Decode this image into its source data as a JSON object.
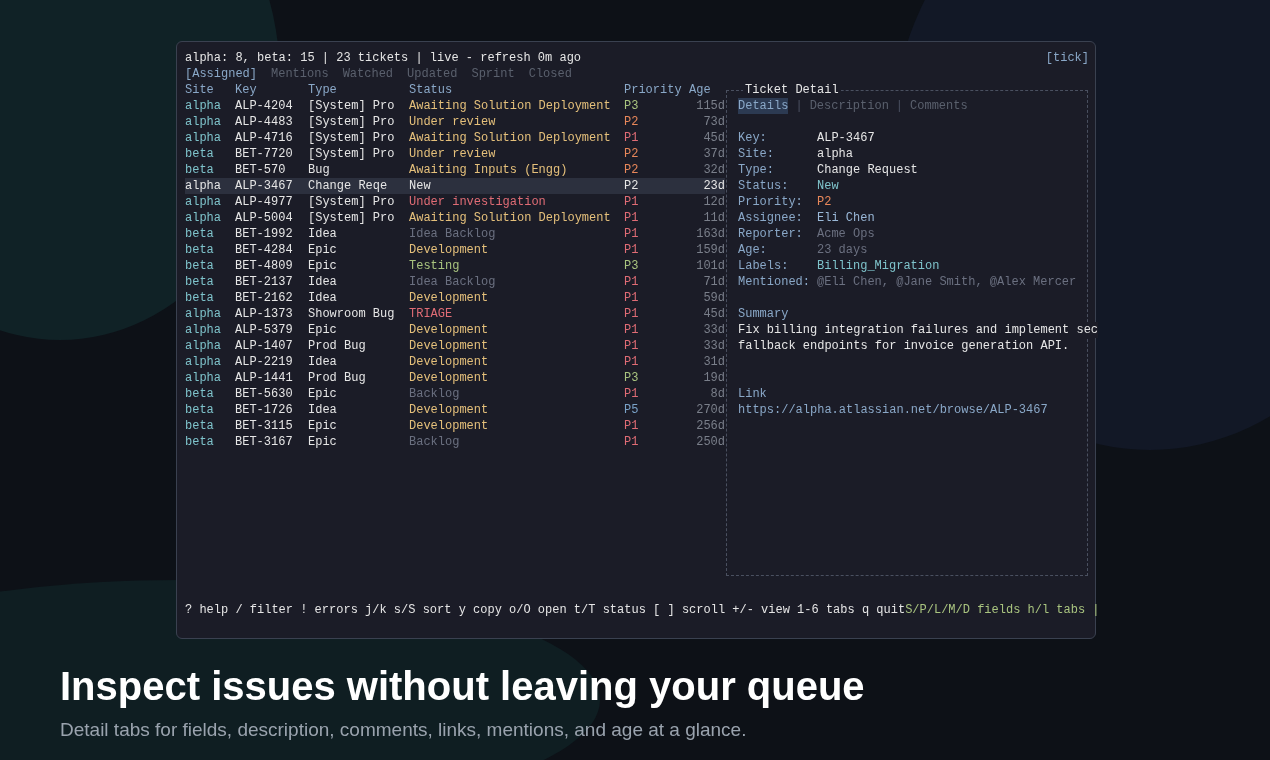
{
  "header": {
    "summary": "alpha: 8, beta: 15 | 23 tickets | live - refresh 0m ago",
    "tick": "[tick]"
  },
  "tabs": [
    {
      "label": "[Assigned]",
      "selected": true
    },
    {
      "label": "Mentions",
      "selected": false
    },
    {
      "label": "Watched",
      "selected": false
    },
    {
      "label": "Updated",
      "selected": false
    },
    {
      "label": "Sprint",
      "selected": false
    },
    {
      "label": "Closed",
      "selected": false
    }
  ],
  "table": {
    "columns": [
      "Site",
      "Key",
      "Type",
      "Status",
      "Priority",
      "Age"
    ],
    "rows": [
      {
        "site": "alpha",
        "key": "ALP-4204",
        "type": "[System] Pro",
        "status": {
          "text": "Awaiting Solution Deployment",
          "color": "#e5c07b"
        },
        "priority": {
          "text": "P3",
          "color": "#a9c47f"
        },
        "age": "115d",
        "selected": false
      },
      {
        "site": "alpha",
        "key": "ALP-4483",
        "type": "[System] Pro",
        "status": {
          "text": "Under review",
          "color": "#e5c07b"
        },
        "priority": {
          "text": "P2",
          "color": "#e8875a"
        },
        "age": "73d",
        "selected": false
      },
      {
        "site": "alpha",
        "key": "ALP-4716",
        "type": "[System] Pro",
        "status": {
          "text": "Awaiting Solution Deployment",
          "color": "#e5c07b"
        },
        "priority": {
          "text": "P1",
          "color": "#e06c75"
        },
        "age": "45d",
        "selected": false
      },
      {
        "site": "beta",
        "key": "BET-7720",
        "type": "[System] Pro",
        "status": {
          "text": "Under review",
          "color": "#e5c07b"
        },
        "priority": {
          "text": "P2",
          "color": "#e8875a"
        },
        "age": "37d",
        "selected": false
      },
      {
        "site": "beta",
        "key": "BET-570",
        "type": "Bug",
        "status": {
          "text": "Awaiting Inputs (Engg)",
          "color": "#e5c07b"
        },
        "priority": {
          "text": "P2",
          "color": "#e8875a"
        },
        "age": "32d",
        "selected": false
      },
      {
        "site": "alpha",
        "key": "ALP-3467",
        "type": "Change Reqe",
        "status": {
          "text": "New",
          "color": "#e6e6e6"
        },
        "priority": {
          "text": "P2",
          "color": "#e6e6e6"
        },
        "age": "23d",
        "selected": true
      },
      {
        "site": "alpha",
        "key": "ALP-4977",
        "type": "[System] Pro",
        "status": {
          "text": "Under investigation",
          "color": "#e06c75"
        },
        "priority": {
          "text": "P1",
          "color": "#e06c75"
        },
        "age": "12d",
        "selected": false
      },
      {
        "site": "alpha",
        "key": "ALP-5004",
        "type": "[System] Pro",
        "status": {
          "text": "Awaiting Solution Deployment",
          "color": "#e5c07b"
        },
        "priority": {
          "text": "P1",
          "color": "#e06c75"
        },
        "age": "11d",
        "selected": false
      },
      {
        "site": "beta",
        "key": "BET-1992",
        "type": "Idea",
        "status": {
          "text": "Idea Backlog",
          "color": "#6b7080"
        },
        "priority": {
          "text": "P1",
          "color": "#e06c75"
        },
        "age": "163d",
        "selected": false
      },
      {
        "site": "beta",
        "key": "BET-4284",
        "type": "Epic",
        "status": {
          "text": "Development",
          "color": "#e5c07b"
        },
        "priority": {
          "text": "P1",
          "color": "#e06c75"
        },
        "age": "159d",
        "selected": false
      },
      {
        "site": "beta",
        "key": "BET-4809",
        "type": "Epic",
        "status": {
          "text": "Testing",
          "color": "#a9c47f"
        },
        "priority": {
          "text": "P3",
          "color": "#a9c47f"
        },
        "age": "101d",
        "selected": false
      },
      {
        "site": "beta",
        "key": "BET-2137",
        "type": "Idea",
        "status": {
          "text": "Idea Backlog",
          "color": "#6b7080"
        },
        "priority": {
          "text": "P1",
          "color": "#e06c75"
        },
        "age": "71d",
        "selected": false
      },
      {
        "site": "beta",
        "key": "BET-2162",
        "type": "Idea",
        "status": {
          "text": "Development",
          "color": "#e5c07b"
        },
        "priority": {
          "text": "P1",
          "color": "#e06c75"
        },
        "age": "59d",
        "selected": false
      },
      {
        "site": "alpha",
        "key": "ALP-1373",
        "type": "Showroom Bug",
        "status": {
          "text": "TRIAGE",
          "color": "#e06c75"
        },
        "priority": {
          "text": "P1",
          "color": "#e06c75"
        },
        "age": "45d",
        "selected": false
      },
      {
        "site": "alpha",
        "key": "ALP-5379",
        "type": "Epic",
        "status": {
          "text": "Development",
          "color": "#e5c07b"
        },
        "priority": {
          "text": "P1",
          "color": "#e06c75"
        },
        "age": "33d",
        "selected": false
      },
      {
        "site": "alpha",
        "key": "ALP-1407",
        "type": "Prod Bug",
        "status": {
          "text": "Development",
          "color": "#e5c07b"
        },
        "priority": {
          "text": "P1",
          "color": "#e06c75"
        },
        "age": "33d",
        "selected": false
      },
      {
        "site": "alpha",
        "key": "ALP-2219",
        "type": "Idea",
        "status": {
          "text": "Development",
          "color": "#e5c07b"
        },
        "priority": {
          "text": "P1",
          "color": "#e06c75"
        },
        "age": "31d",
        "selected": false
      },
      {
        "site": "alpha",
        "key": "ALP-1441",
        "type": "Prod Bug",
        "status": {
          "text": "Development",
          "color": "#e5c07b"
        },
        "priority": {
          "text": "P3",
          "color": "#a9c47f"
        },
        "age": "19d",
        "selected": false
      },
      {
        "site": "beta",
        "key": "BET-5630",
        "type": "Epic",
        "status": {
          "text": "Backlog",
          "color": "#6b7080"
        },
        "priority": {
          "text": "P1",
          "color": "#e06c75"
        },
        "age": "8d",
        "selected": false
      },
      {
        "site": "beta",
        "key": "BET-1726",
        "type": "Idea",
        "status": {
          "text": "Development",
          "color": "#e5c07b"
        },
        "priority": {
          "text": "P5",
          "color": "#7aa2c8"
        },
        "age": "270d",
        "selected": false
      },
      {
        "site": "beta",
        "key": "BET-3115",
        "type": "Epic",
        "status": {
          "text": "Development",
          "color": "#e5c07b"
        },
        "priority": {
          "text": "P1",
          "color": "#e06c75"
        },
        "age": "256d",
        "selected": false
      },
      {
        "site": "beta",
        "key": "BET-3167",
        "type": "Epic",
        "status": {
          "text": "Backlog",
          "color": "#6b7080"
        },
        "priority": {
          "text": "P1",
          "color": "#e06c75"
        },
        "age": "250d",
        "selected": false
      }
    ]
  },
  "detail": {
    "title": "Ticket Detail",
    "tab_separator": "|",
    "tabs": [
      {
        "label": "Details",
        "selected": true
      },
      {
        "label": "Description",
        "selected": false
      },
      {
        "label": "Comments",
        "selected": false
      }
    ],
    "fields": [
      {
        "label": "Key:",
        "value": "ALP-3467",
        "color": "#e6e6e6"
      },
      {
        "label": "Site:",
        "value": "alpha",
        "color": "#e6e6e6"
      },
      {
        "label": "Type:",
        "value": "Change Request",
        "color": "#e6e6e6"
      },
      {
        "label": "Status:",
        "value": "New",
        "color": "#7fc4cc"
      },
      {
        "label": "Priority:",
        "value": "P2",
        "color": "#e8875a"
      },
      {
        "label": "Assignee:",
        "value": "Eli Chen",
        "color": "#9ab8d8"
      },
      {
        "label": "Reporter:",
        "value": "Acme Ops",
        "color": "#6b7080"
      },
      {
        "label": "Age:",
        "value": "23 days",
        "color": "#6b7080"
      },
      {
        "label": "Labels:",
        "value": "Billing_Migration",
        "color": "#7fc4cc"
      },
      {
        "label": "Mentioned:",
        "value": "@Eli Chen, @Jane Smith, @Alex Mercer",
        "color": "#6b7080"
      }
    ],
    "summary_heading": "Summary",
    "summary": [
      "Fix billing integration failures and implement sec",
      "fallback endpoints for invoice generation API."
    ],
    "link_heading": "Link",
    "link": "https://alpha.atlassian.net/browse/ALP-3467"
  },
  "help": {
    "keys": "? help / filter ! errors j/k s/S sort y copy o/O open t/T status [ ] scroll +/- view 1-6 tabs q quit",
    "fields": "S/P/L/M/D fields h/l tabs |"
  },
  "caption": {
    "title": "Inspect issues without leaving your queue",
    "subtitle": "Detail tabs for fields, description, comments, links, mentions, and age at a glance."
  }
}
